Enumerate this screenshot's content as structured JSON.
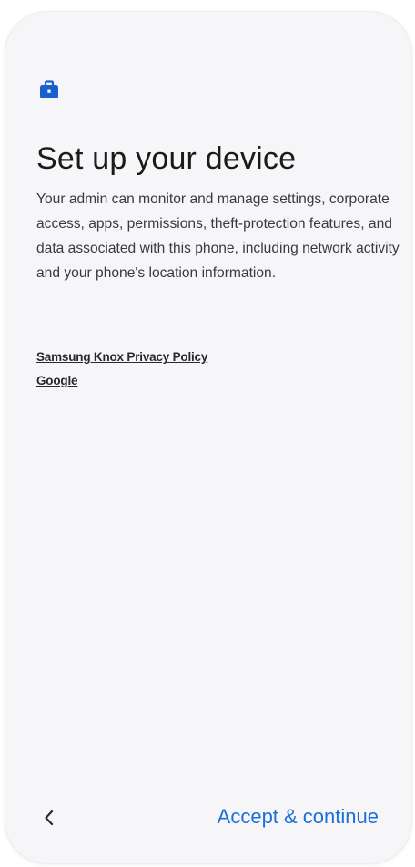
{
  "header": {
    "icon": "briefcase-icon",
    "icon_color": "#1a5fd0"
  },
  "main": {
    "title": "Set up your device",
    "description": "Your admin can monitor and manage settings, corporate access, apps, permissions, theft-protection features, and data associated with this phone, including network activity and your phone's location information.",
    "links": [
      {
        "label": "Samsung Knox Privacy Policy"
      },
      {
        "label": "Google"
      }
    ]
  },
  "footer": {
    "back_icon": "chevron-left-icon",
    "accept_label": "Accept & continue",
    "accent_color": "#1d6fd8"
  }
}
